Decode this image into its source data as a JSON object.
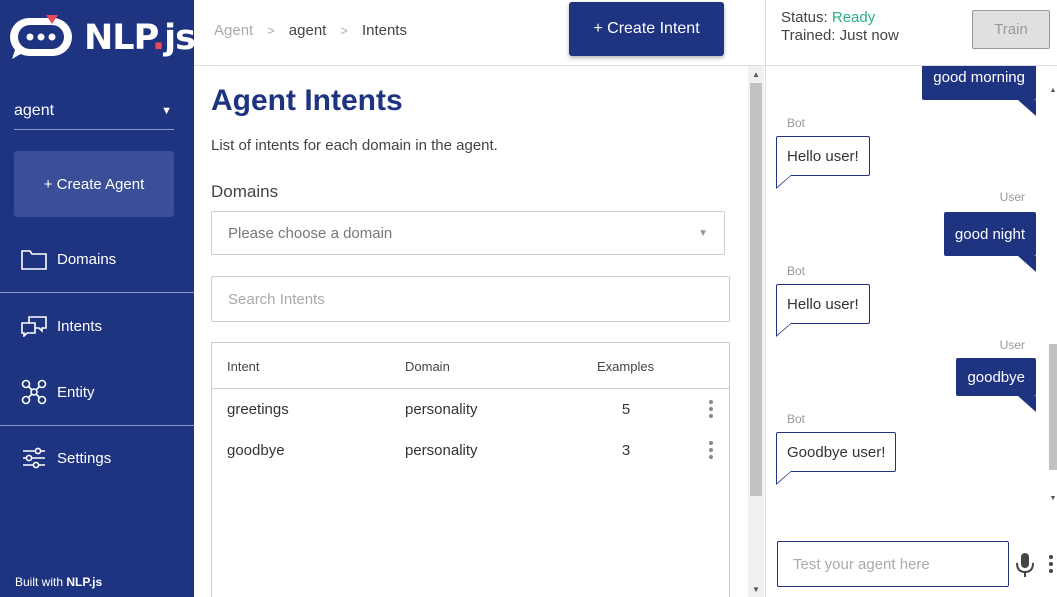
{
  "app": {
    "logo_text": "NLP",
    "logo_dot": ".",
    "logo_suffix": "js"
  },
  "sidebar": {
    "agent_selected": "agent",
    "create_agent_label": "+ Create Agent",
    "items": [
      {
        "label": "Domains",
        "icon": "folder-icon"
      },
      {
        "label": "Intents",
        "icon": "chat-bubbles-icon"
      },
      {
        "label": "Entity",
        "icon": "network-icon"
      },
      {
        "label": "Settings",
        "icon": "sliders-icon"
      }
    ],
    "built_with_prefix": "Built with ",
    "built_with_brand": "NLP.js"
  },
  "header": {
    "breadcrumb": [
      "Agent",
      "agent",
      "Intents"
    ],
    "create_intent_label": "+ Create Intent"
  },
  "main": {
    "title": "Agent Intents",
    "description": "List of intents for each domain in the agent.",
    "domains_label": "Domains",
    "domain_placeholder": "Please choose a domain",
    "search_placeholder": "Search Intents",
    "table": {
      "columns": [
        "Intent",
        "Domain",
        "Examples"
      ],
      "rows": [
        {
          "intent": "greetings",
          "domain": "personality",
          "examples": "5"
        },
        {
          "intent": "goodbye",
          "domain": "personality",
          "examples": "3"
        }
      ]
    }
  },
  "chat": {
    "status_label": "Status: ",
    "status_value": "Ready",
    "trained_label": "Trained: Just now",
    "train_button": "Train",
    "messages": [
      {
        "from": "user",
        "sender": "",
        "text": "good morning"
      },
      {
        "from": "bot",
        "sender": "Bot",
        "text": "Hello user!"
      },
      {
        "from": "user",
        "sender": "User",
        "text": "good night"
      },
      {
        "from": "bot",
        "sender": "Bot",
        "text": "Hello user!"
      },
      {
        "from": "user",
        "sender": "User",
        "text": "goodbye"
      },
      {
        "from": "bot",
        "sender": "Bot",
        "text": "Goodbye user!"
      }
    ],
    "input_placeholder": "Test your agent here"
  },
  "colors": {
    "brand": "#1e3481",
    "ready": "#27b08a",
    "logo_accent": "#e84c5a"
  }
}
